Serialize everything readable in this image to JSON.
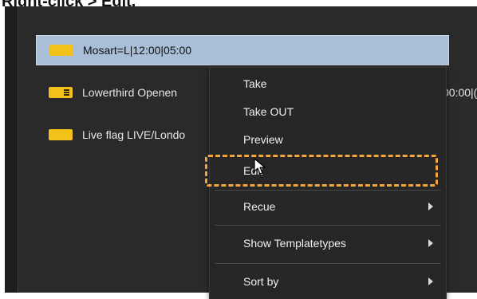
{
  "caption": "Right-click > Edit.",
  "rows": [
    {
      "label": "Mosart=L|12:00|05:00",
      "swatch_color": "#f2c21b",
      "icon": "template-swatch-icon"
    },
    {
      "label": "Lowerthird Openen",
      "trailing": "00:00|(",
      "swatch_color": "#f2c21b",
      "icon": "template-swatch-lines-icon"
    },
    {
      "label": "Live flag LIVE/Londo",
      "swatch_color": "#f2c21b",
      "icon": "template-swatch-icon"
    }
  ],
  "context_menu": {
    "items": [
      {
        "label": "Take",
        "submenu": false
      },
      {
        "label": "Take OUT",
        "submenu": false
      },
      {
        "label": "Preview",
        "submenu": false
      },
      {
        "label": "Edit",
        "submenu": false
      },
      {
        "label": "Recue",
        "submenu": true
      },
      {
        "label": "Show Templatetypes",
        "submenu": true
      },
      {
        "label": "Sort by",
        "submenu": true
      }
    ],
    "highlighted_item": "Edit",
    "highlight_color": "#f3a63c"
  },
  "colors": {
    "background": "#1e1e1e",
    "panel": "#2a2a2a",
    "selected_row": "#a9bfd8",
    "swatch": "#f2c21b"
  }
}
